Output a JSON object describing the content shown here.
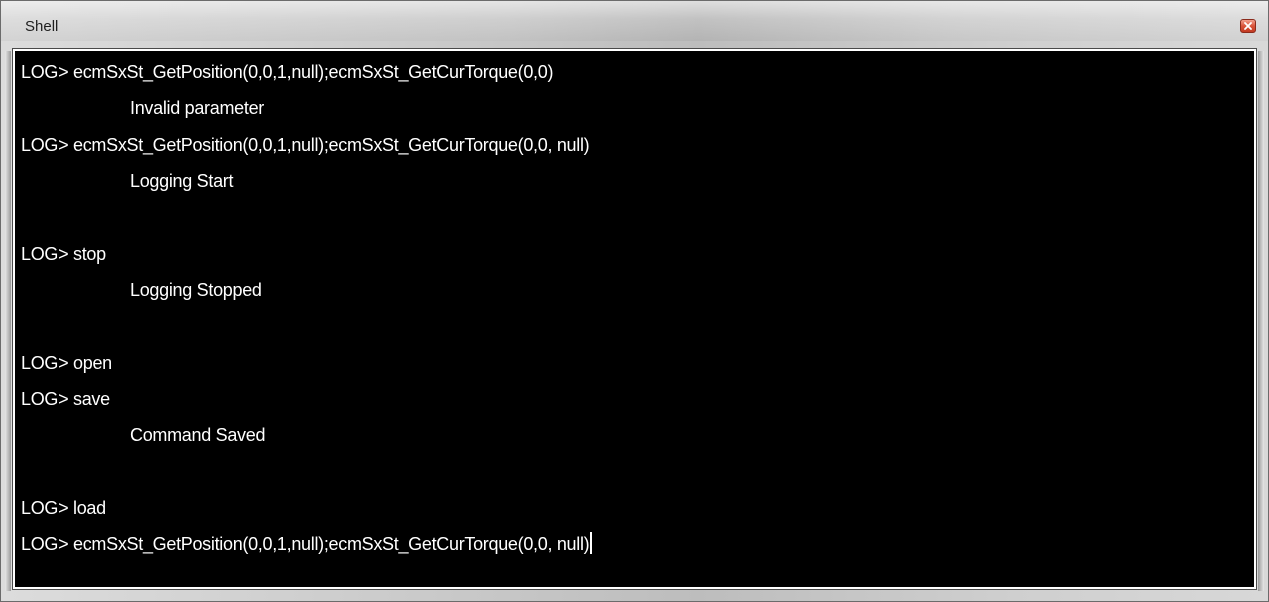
{
  "window": {
    "title": "Shell",
    "close_icon": "close-icon"
  },
  "terminal": {
    "lines": [
      "LOG> ecmSxSt_GetPosition(0,0,1,null);ecmSxSt_GetCurTorque(0,0)",
      "Invalid parameter",
      "LOG> ecmSxSt_GetPosition(0,0,1,null);ecmSxSt_GetCurTorque(0,0, null)",
      "Logging Start",
      "",
      "LOG> stop",
      "Logging Stopped",
      "",
      "LOG> open",
      "LOG> save",
      "Command Saved",
      "",
      "LOG> load",
      "LOG> ecmSxSt_GetPosition(0,0,1,null);ecmSxSt_GetCurTorque(0,0, null)"
    ]
  },
  "colors": {
    "terminal_background": "#000000",
    "terminal_text": "#ffffff",
    "close_button": "#d9543a"
  }
}
